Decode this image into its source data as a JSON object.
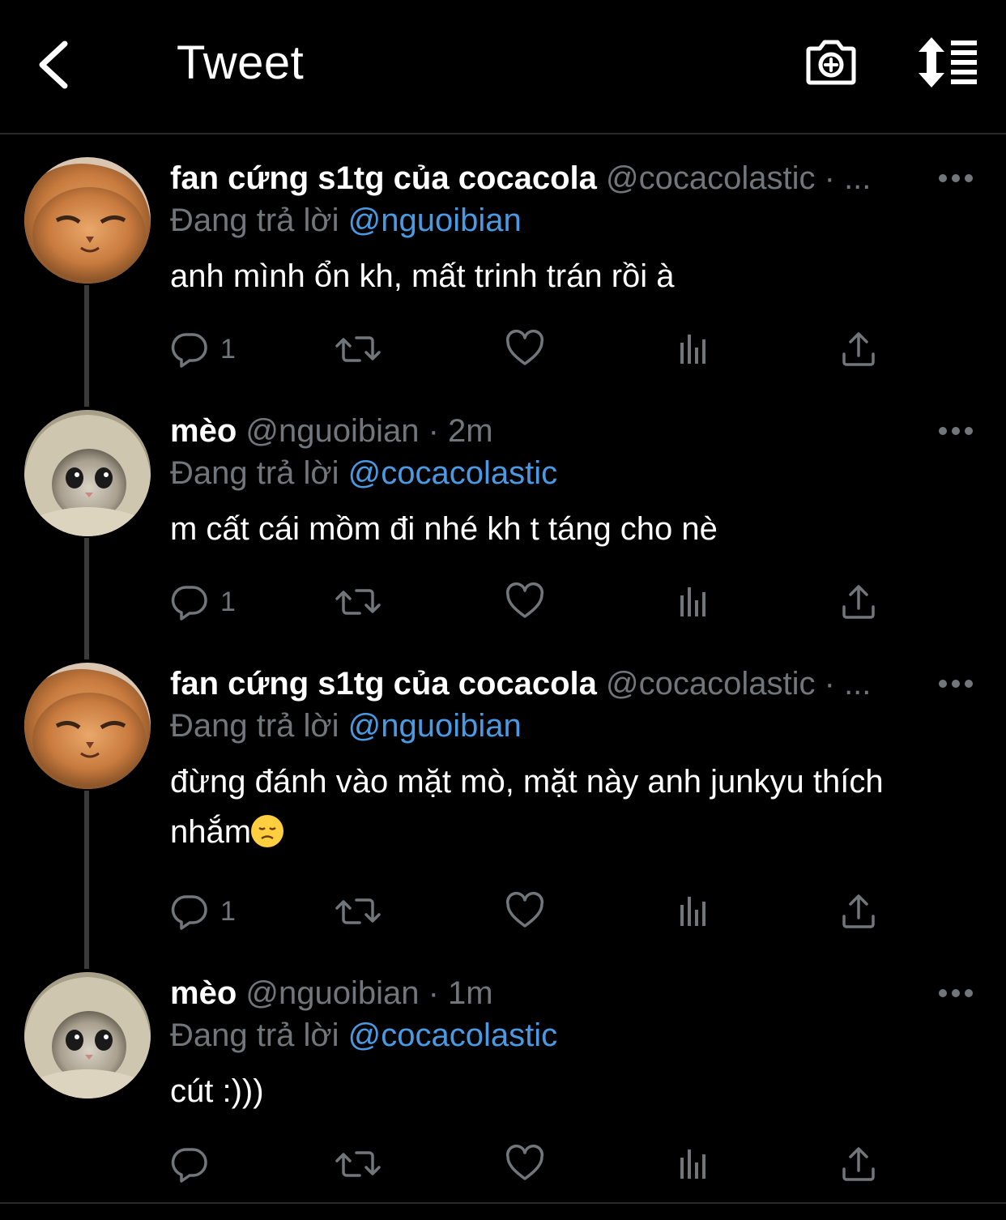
{
  "header": {
    "title": "Tweet",
    "back_icon": "chevron-left-icon",
    "camera_icon": "camera-add-icon",
    "sort_icon": "sort-list-icon"
  },
  "tweets": [
    {
      "name": "fan cứng s1tg của cocacola",
      "handle": "@cocacolastic · ...",
      "reply_prefix": "Đang trả lời",
      "reply_to": "@nguoibian",
      "text": "anh mình ổn kh, mất trinh trán rồi à",
      "reply_count": "1",
      "avatar": "orange-cat-avatar"
    },
    {
      "name": "mèo",
      "handle": "@nguoibian · 2m",
      "reply_prefix": "Đang trả lời",
      "reply_to": "@cocacolastic",
      "text": "m cất cái mồm đi nhé kh t táng cho nè",
      "reply_count": "1",
      "avatar": "hooded-cat-avatar"
    },
    {
      "name": "fan cứng s1tg của cocacola",
      "handle": "@cocacolastic · ...",
      "reply_prefix": "Đang trả lời",
      "reply_to": "@nguoibian",
      "text_line1": "đừng đánh vào mặt mò, mặt này anh junkyu thích",
      "text_line2": "nhắm",
      "emoji": "disappointed-face-emoji",
      "reply_count": "1",
      "avatar": "orange-cat-avatar"
    },
    {
      "name": "mèo",
      "handle": "@nguoibian · 1m",
      "reply_prefix": "Đang trả lời",
      "reply_to": "@cocacolastic",
      "text": "cút :)))",
      "reply_count": "",
      "avatar": "hooded-cat-avatar"
    }
  ],
  "colors": {
    "background": "#000000",
    "muted": "#71767b",
    "mention": "#4a9ae3"
  }
}
